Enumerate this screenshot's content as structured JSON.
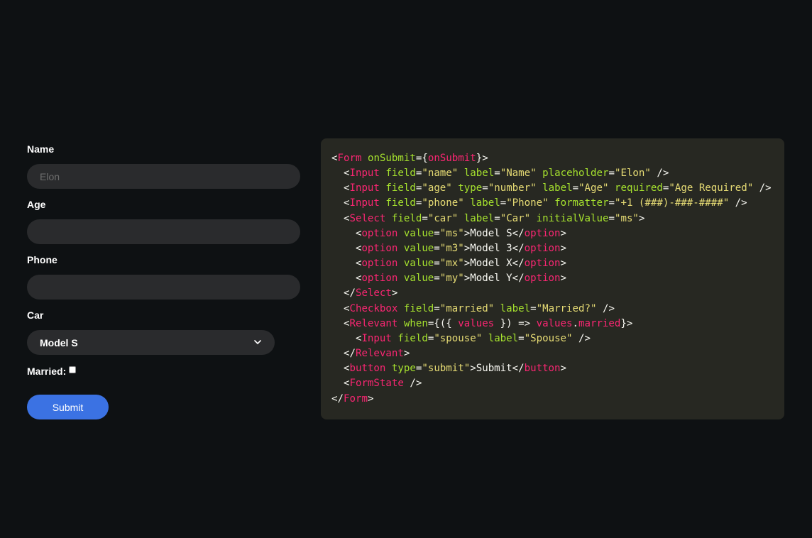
{
  "form": {
    "name": {
      "label": "Name",
      "placeholder": "Elon",
      "value": ""
    },
    "age": {
      "label": "Age",
      "value": ""
    },
    "phone": {
      "label": "Phone",
      "value": ""
    },
    "car": {
      "label": "Car",
      "selected": "Model S",
      "icon": "chevron-down-icon"
    },
    "married": {
      "label": "Married:",
      "checked": false
    },
    "submit_label": "Submit"
  },
  "colors": {
    "background": "#0e1113",
    "input_bg": "#2a2b2d",
    "button": "#3b72e3",
    "code_bg": "#272822",
    "code_tag": "#f92672",
    "code_attr": "#a6e22e",
    "code_string": "#e6db74",
    "code_text": "#f8f8f2"
  },
  "code_lines": [
    [
      [
        "p",
        "<"
      ],
      [
        "t",
        "Form"
      ],
      [
        "p",
        " "
      ],
      [
        "a",
        "onSubmit"
      ],
      [
        "p",
        "={"
      ],
      [
        "t",
        "onSubmit"
      ],
      [
        "p",
        "}>"
      ]
    ],
    [
      [
        "p",
        "  <"
      ],
      [
        "t",
        "Input"
      ],
      [
        "p",
        " "
      ],
      [
        "a",
        "field"
      ],
      [
        "p",
        "="
      ],
      [
        "s",
        "\"name\""
      ],
      [
        "p",
        " "
      ],
      [
        "a",
        "label"
      ],
      [
        "p",
        "="
      ],
      [
        "s",
        "\"Name\""
      ],
      [
        "p",
        " "
      ],
      [
        "a",
        "placeholder"
      ],
      [
        "p",
        "="
      ],
      [
        "s",
        "\"Elon\""
      ],
      [
        "p",
        " />"
      ]
    ],
    [
      [
        "p",
        "  <"
      ],
      [
        "t",
        "Input"
      ],
      [
        "p",
        " "
      ],
      [
        "a",
        "field"
      ],
      [
        "p",
        "="
      ],
      [
        "s",
        "\"age\""
      ],
      [
        "p",
        " "
      ],
      [
        "a",
        "type"
      ],
      [
        "p",
        "="
      ],
      [
        "s",
        "\"number\""
      ],
      [
        "p",
        " "
      ],
      [
        "a",
        "label"
      ],
      [
        "p",
        "="
      ],
      [
        "s",
        "\"Age\""
      ],
      [
        "p",
        " "
      ],
      [
        "a",
        "required"
      ],
      [
        "p",
        "="
      ],
      [
        "s",
        "\"Age Required\""
      ],
      [
        "p",
        " />"
      ]
    ],
    [
      [
        "p",
        "  <"
      ],
      [
        "t",
        "Input"
      ],
      [
        "p",
        " "
      ],
      [
        "a",
        "field"
      ],
      [
        "p",
        "="
      ],
      [
        "s",
        "\"phone\""
      ],
      [
        "p",
        " "
      ],
      [
        "a",
        "label"
      ],
      [
        "p",
        "="
      ],
      [
        "s",
        "\"Phone\""
      ],
      [
        "p",
        " "
      ],
      [
        "a",
        "formatter"
      ],
      [
        "p",
        "="
      ],
      [
        "s",
        "\"+1 (###)-###-####\""
      ],
      [
        "p",
        " />"
      ]
    ],
    [
      [
        "p",
        "  <"
      ],
      [
        "t",
        "Select"
      ],
      [
        "p",
        " "
      ],
      [
        "a",
        "field"
      ],
      [
        "p",
        "="
      ],
      [
        "s",
        "\"car\""
      ],
      [
        "p",
        " "
      ],
      [
        "a",
        "label"
      ],
      [
        "p",
        "="
      ],
      [
        "s",
        "\"Car\""
      ],
      [
        "p",
        " "
      ],
      [
        "a",
        "initialValue"
      ],
      [
        "p",
        "="
      ],
      [
        "s",
        "\"ms\""
      ],
      [
        "p",
        ">"
      ]
    ],
    [
      [
        "p",
        "    <"
      ],
      [
        "t",
        "option"
      ],
      [
        "p",
        " "
      ],
      [
        "a",
        "value"
      ],
      [
        "p",
        "="
      ],
      [
        "s",
        "\"ms\""
      ],
      [
        "p",
        ">Model S</"
      ],
      [
        "t",
        "option"
      ],
      [
        "p",
        ">"
      ]
    ],
    [
      [
        "p",
        "    <"
      ],
      [
        "t",
        "option"
      ],
      [
        "p",
        " "
      ],
      [
        "a",
        "value"
      ],
      [
        "p",
        "="
      ],
      [
        "s",
        "\"m3\""
      ],
      [
        "p",
        ">Model 3</"
      ],
      [
        "t",
        "option"
      ],
      [
        "p",
        ">"
      ]
    ],
    [
      [
        "p",
        "    <"
      ],
      [
        "t",
        "option"
      ],
      [
        "p",
        " "
      ],
      [
        "a",
        "value"
      ],
      [
        "p",
        "="
      ],
      [
        "s",
        "\"mx\""
      ],
      [
        "p",
        ">Model X</"
      ],
      [
        "t",
        "option"
      ],
      [
        "p",
        ">"
      ]
    ],
    [
      [
        "p",
        "    <"
      ],
      [
        "t",
        "option"
      ],
      [
        "p",
        " "
      ],
      [
        "a",
        "value"
      ],
      [
        "p",
        "="
      ],
      [
        "s",
        "\"my\""
      ],
      [
        "p",
        ">Model Y</"
      ],
      [
        "t",
        "option"
      ],
      [
        "p",
        ">"
      ]
    ],
    [
      [
        "p",
        "  </"
      ],
      [
        "t",
        "Select"
      ],
      [
        "p",
        ">"
      ]
    ],
    [
      [
        "p",
        "  <"
      ],
      [
        "t",
        "Checkbox"
      ],
      [
        "p",
        " "
      ],
      [
        "a",
        "field"
      ],
      [
        "p",
        "="
      ],
      [
        "s",
        "\"married\""
      ],
      [
        "p",
        " "
      ],
      [
        "a",
        "label"
      ],
      [
        "p",
        "="
      ],
      [
        "s",
        "\"Married?\""
      ],
      [
        "p",
        " />"
      ]
    ],
    [
      [
        "p",
        "  <"
      ],
      [
        "t",
        "Relevant"
      ],
      [
        "p",
        " "
      ],
      [
        "a",
        "when"
      ],
      [
        "p",
        "={({ "
      ],
      [
        "t",
        "values"
      ],
      [
        "p",
        " }) => "
      ],
      [
        "t",
        "values"
      ],
      [
        "p",
        "."
      ],
      [
        "t",
        "married"
      ],
      [
        "p",
        "}>"
      ]
    ],
    [
      [
        "p",
        "    <"
      ],
      [
        "t",
        "Input"
      ],
      [
        "p",
        " "
      ],
      [
        "a",
        "field"
      ],
      [
        "p",
        "="
      ],
      [
        "s",
        "\"spouse\""
      ],
      [
        "p",
        " "
      ],
      [
        "a",
        "label"
      ],
      [
        "p",
        "="
      ],
      [
        "s",
        "\"Spouse\""
      ],
      [
        "p",
        " />"
      ]
    ],
    [
      [
        "p",
        "  </"
      ],
      [
        "t",
        "Relevant"
      ],
      [
        "p",
        ">"
      ]
    ],
    [
      [
        "p",
        "  <"
      ],
      [
        "t",
        "button"
      ],
      [
        "p",
        " "
      ],
      [
        "a",
        "type"
      ],
      [
        "p",
        "="
      ],
      [
        "s",
        "\"submit\""
      ],
      [
        "p",
        ">Submit</"
      ],
      [
        "t",
        "button"
      ],
      [
        "p",
        ">"
      ]
    ],
    [
      [
        "p",
        "  <"
      ],
      [
        "t",
        "FormState"
      ],
      [
        "p",
        " />"
      ]
    ],
    [
      [
        "p",
        "</"
      ],
      [
        "t",
        "Form"
      ],
      [
        "p",
        ">"
      ]
    ]
  ]
}
